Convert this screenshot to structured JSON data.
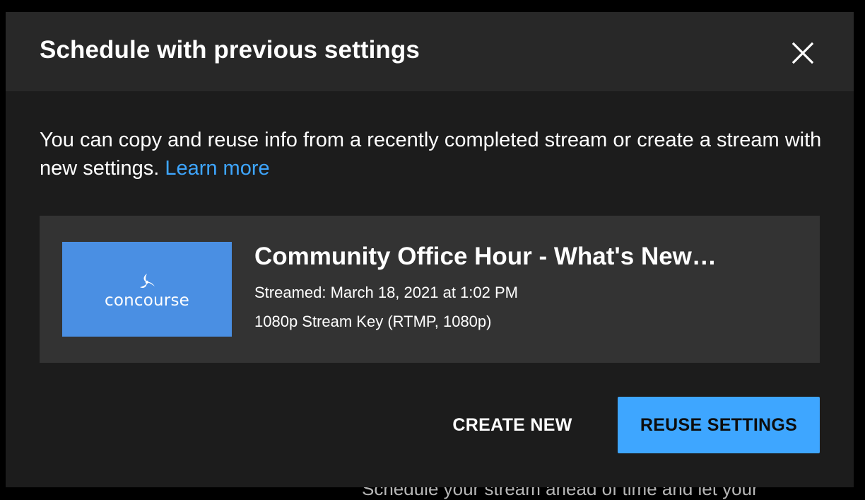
{
  "background": {
    "partial_text": "Schedule your stream ahead of time and let your"
  },
  "dialog": {
    "title": "Schedule with previous settings",
    "close_icon": "close-icon",
    "description": "You can copy and reuse info from a recently completed stream or create a stream with new settings.",
    "learn_more": "Learn more",
    "stream": {
      "thumbnail_brand": "concourse",
      "thumbnail_color": "#4a8fe3",
      "title": "Community Office Hour - What's New…",
      "streamed": "Streamed: March 18, 2021 at 1:02 PM",
      "stream_key": "1080p Stream Key (RTMP, 1080p)"
    },
    "buttons": {
      "create_new": "CREATE NEW",
      "reuse_settings": "REUSE SETTINGS"
    }
  },
  "colors": {
    "accent": "#3ea6ff",
    "dialog_bg": "#1c1c1c",
    "header_bg": "#282828",
    "card_bg": "#333333"
  }
}
